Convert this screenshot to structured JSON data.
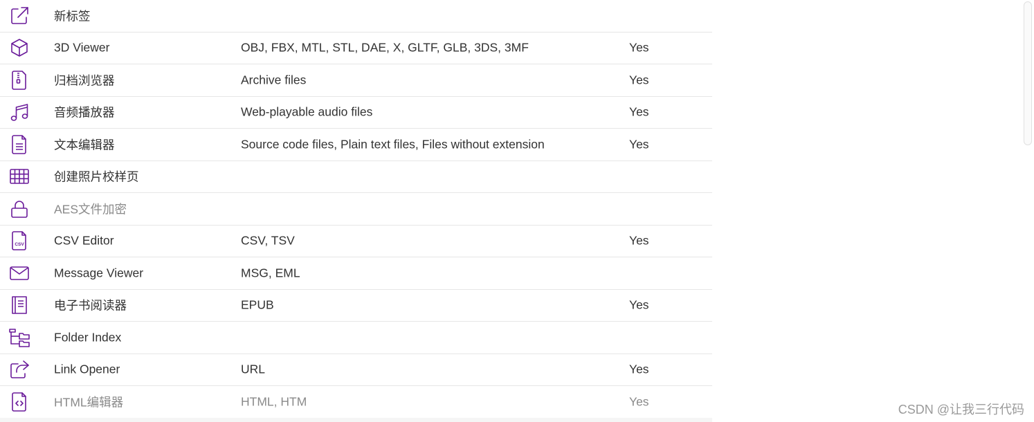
{
  "rows": [
    {
      "icon": "external-link-icon",
      "name": "新标签",
      "formats": "",
      "local": ""
    },
    {
      "icon": "cube-icon",
      "name": "3D Viewer",
      "formats": "OBJ, FBX, MTL, STL, DAE, X, GLTF, GLB, 3DS, 3MF",
      "local": "Yes"
    },
    {
      "icon": "archive-file-icon",
      "name": "归档浏览器",
      "formats": "Archive files",
      "local": "Yes"
    },
    {
      "icon": "music-note-icon",
      "name": "音频播放器",
      "formats": "Web-playable audio files",
      "local": "Yes"
    },
    {
      "icon": "text-file-icon",
      "name": "文本编辑器",
      "formats": "Source code files, Plain text files, Files without extension",
      "local": "Yes"
    },
    {
      "icon": "grid-icon",
      "name": "创建照片校样页",
      "formats": "",
      "local": ""
    },
    {
      "icon": "lock-icon",
      "name": "AES文件加密",
      "formats": "",
      "local": ""
    },
    {
      "icon": "csv-file-icon",
      "name": "CSV Editor",
      "formats": "CSV, TSV",
      "local": "Yes"
    },
    {
      "icon": "envelope-icon",
      "name": "Message Viewer",
      "formats": "MSG, EML",
      "local": ""
    },
    {
      "icon": "book-icon",
      "name": "电子书阅读器",
      "formats": "EPUB",
      "local": "Yes"
    },
    {
      "icon": "folder-tree-icon",
      "name": "Folder Index",
      "formats": "",
      "local": ""
    },
    {
      "icon": "share-icon",
      "name": "Link Opener",
      "formats": "URL",
      "local": "Yes"
    },
    {
      "icon": "code-file-icon",
      "name": "HTML编辑器",
      "formats": "HTML, HTM",
      "local": "Yes"
    }
  ],
  "watermark": "CSDN @让我三行代码",
  "colors": {
    "icon": "#6a1b9a",
    "text": "#333333",
    "muted": "#8a8a8a",
    "divider": "#e6e6e6"
  }
}
